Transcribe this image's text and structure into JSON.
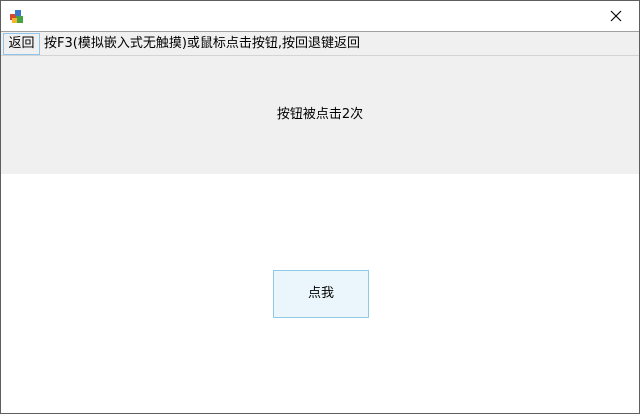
{
  "titlebar": {
    "app_icon": "app-icon",
    "close_icon": "close-icon"
  },
  "toolbar": {
    "back_label": "返回",
    "hint": "按F3(模拟嵌入式无触摸)或鼠标点击按钮,按回退键返回"
  },
  "status": {
    "text": "按钮被点击2次"
  },
  "main": {
    "button_label": "点我"
  }
}
